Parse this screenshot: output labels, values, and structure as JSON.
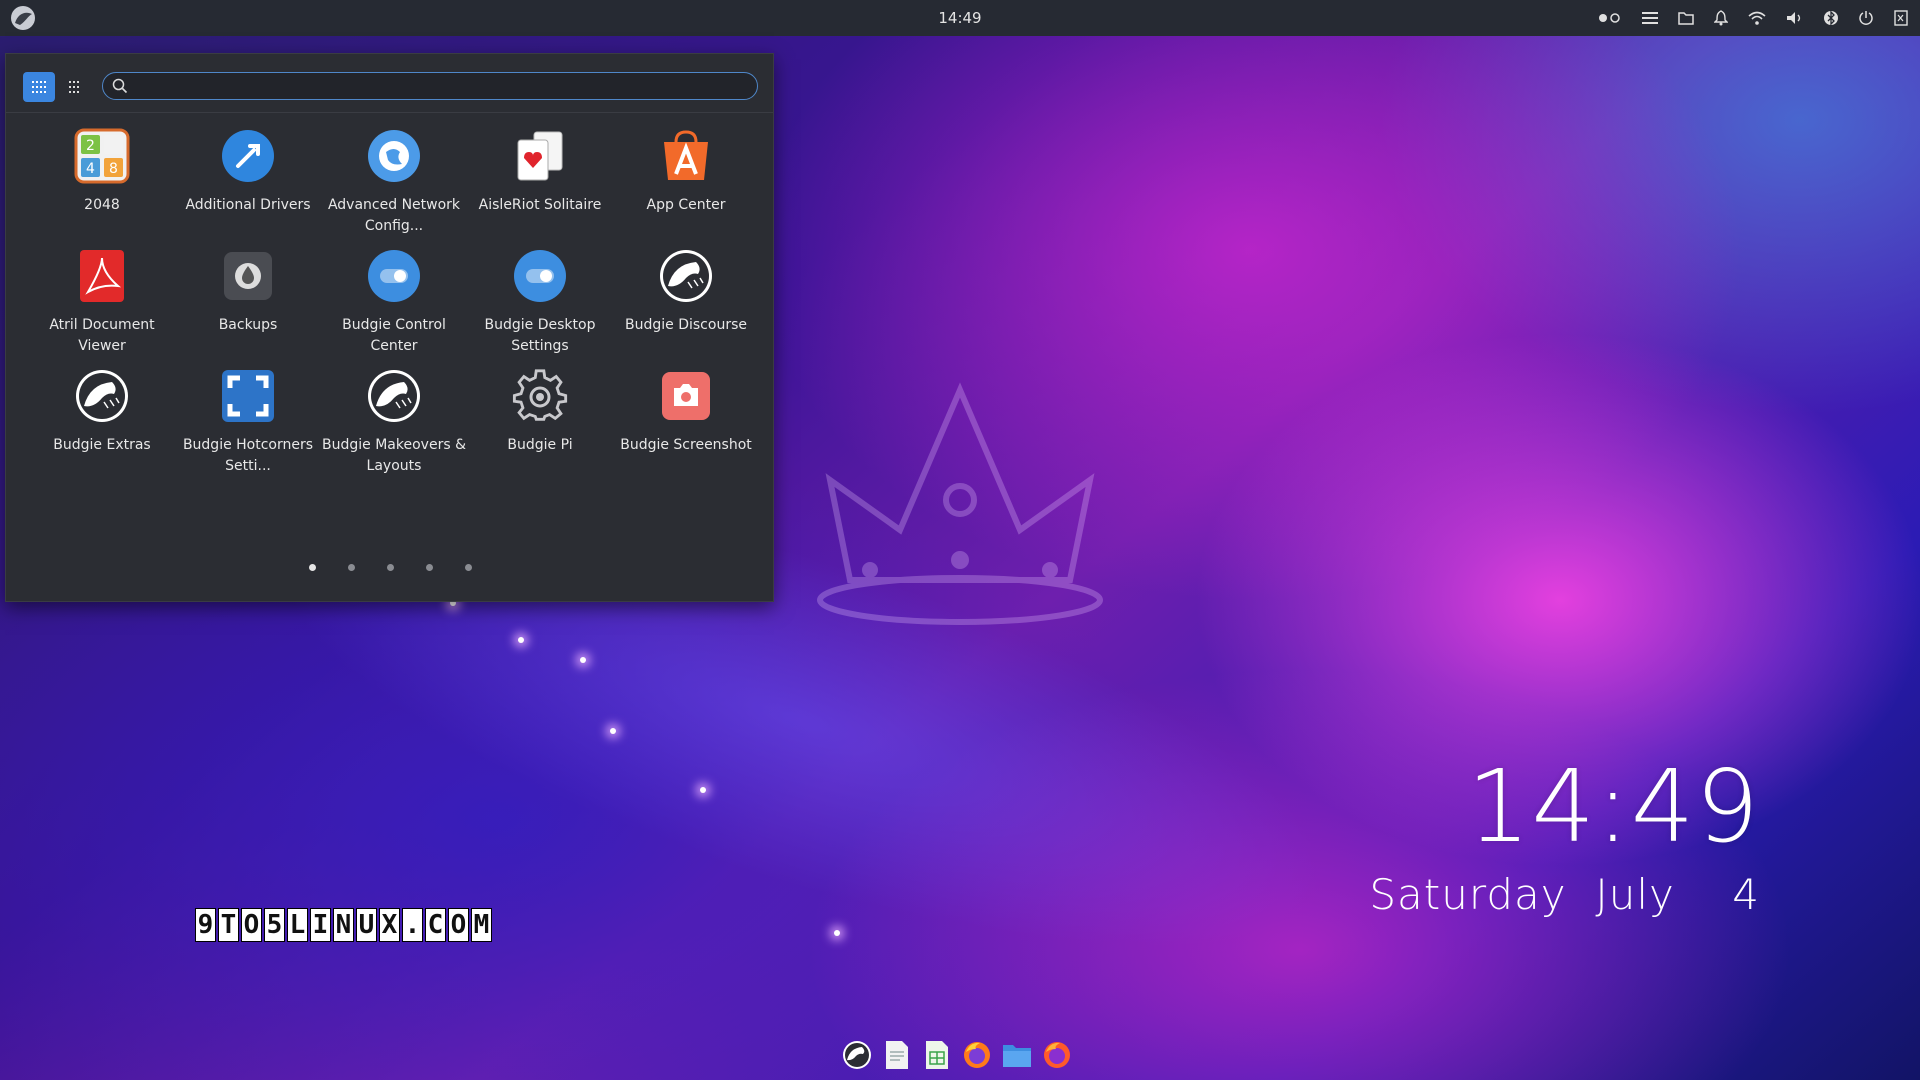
{
  "topbar": {
    "clock": "14:49",
    "menu_icon": "budgie-logo-icon",
    "tray_icons": [
      "workspace-indicator-icon",
      "hamburger-menu-icon",
      "folder-icon",
      "bell-icon",
      "wifi-icon",
      "volume-icon",
      "bluetooth-icon",
      "power-icon",
      "raven-panel-icon"
    ]
  },
  "menu": {
    "view_modes": [
      "grid-view-icon",
      "list-view-icon"
    ],
    "search": {
      "placeholder": "",
      "value": ""
    },
    "apps": [
      {
        "label": "2048",
        "icon": "game-2048-icon"
      },
      {
        "label": "Additional Drivers",
        "icon": "additional-drivers-icon"
      },
      {
        "label": "Advanced Network Config...",
        "icon": "network-config-icon"
      },
      {
        "label": "AisleRiot Solitaire",
        "icon": "solitaire-icon"
      },
      {
        "label": "App Center",
        "icon": "app-center-icon"
      },
      {
        "label": "Atril Document Viewer",
        "icon": "pdf-viewer-icon"
      },
      {
        "label": "Backups",
        "icon": "backups-icon"
      },
      {
        "label": "Budgie Control Center",
        "icon": "control-center-icon"
      },
      {
        "label": "Budgie Desktop Settings",
        "icon": "desktop-settings-icon"
      },
      {
        "label": "Budgie Discourse",
        "icon": "budgie-logo-icon"
      },
      {
        "label": "Budgie Extras",
        "icon": "budgie-logo-icon"
      },
      {
        "label": "Budgie Hotcorners Setti...",
        "icon": "hotcorners-icon"
      },
      {
        "label": "Budgie Makeovers & Layouts",
        "icon": "budgie-logo-icon"
      },
      {
        "label": "Budgie Pi",
        "icon": "gear-icon"
      },
      {
        "label": "Budgie Screenshot",
        "icon": "camera-icon"
      }
    ],
    "pages": 5,
    "active_page": 1
  },
  "desktop": {
    "time": "14:49",
    "date": "Saturday  July    4",
    "watermark": [
      "9",
      "T",
      "O",
      "5",
      "L",
      "I",
      "N",
      "U",
      "X",
      ".",
      "C",
      "O",
      "M"
    ]
  },
  "dock": [
    "budgie-welcome-icon",
    "text-editor-icon",
    "spreadsheet-icon",
    "firefox-icon",
    "file-manager-icon",
    "firefox-alt-icon"
  ],
  "colors": {
    "panel": "#262a33",
    "menu_bg": "#2b2d33",
    "accent": "#3b86e0"
  }
}
